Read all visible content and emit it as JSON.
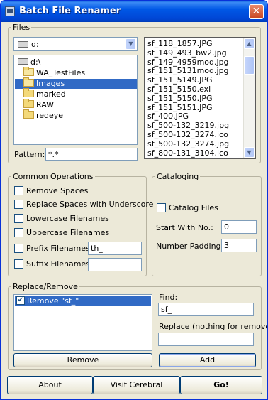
{
  "window": {
    "title": "Batch File Renamer",
    "close_label": "✕"
  },
  "files": {
    "legend": "Files",
    "drive_value": "d:",
    "tree": [
      {
        "label": "d:\\",
        "indent": 0,
        "icon": "drive"
      },
      {
        "label": "WA_TestFiles",
        "indent": 1,
        "icon": "folder-open"
      },
      {
        "label": "Images",
        "indent": 2,
        "icon": "folder-open",
        "selected": true
      },
      {
        "label": "marked",
        "indent": 3,
        "icon": "folder"
      },
      {
        "label": "RAW",
        "indent": 3,
        "icon": "folder"
      },
      {
        "label": "redeye",
        "indent": 3,
        "icon": "folder"
      }
    ],
    "pattern_label": "Pattern:",
    "pattern_value": "*.*",
    "list": [
      "sf_118_1857.JPG",
      "sf_149_493_bw2.jpg",
      "sf_149_4959mod.jpg",
      "sf_151_5131mod.jpg",
      "sf_151_5149.JPG",
      "sf_151_5150.exi",
      "sf_151_5150.JPG",
      "sf_151_5151.JPG",
      "sf_400.JPG",
      "sf_500-132_3219.jpg",
      "sf_500-132_3274.ico",
      "sf_500-132_3274.jpg",
      "sf_800-131_3104.ico"
    ]
  },
  "common": {
    "legend": "Common Operations",
    "remove_spaces": "Remove Spaces",
    "replace_spaces": "Replace Spaces with Underscore",
    "lowercase": "Lowercase Filenames",
    "uppercase": "Uppercase Filenames",
    "prefix": "Prefix Filenames",
    "prefix_value": "th_",
    "suffix": "Suffix Filenames",
    "suffix_value": ""
  },
  "cataloging": {
    "legend": "Cataloging",
    "catalog_files": "Catalog Files",
    "start_with_label": "Start With No.:",
    "start_with_value": "0",
    "padding_label": "Number Padding:",
    "padding_value": "3"
  },
  "replace": {
    "legend": "Replace/Remove",
    "items": [
      "Remove \"sf_\""
    ],
    "find_label": "Find:",
    "find_value": "sf_",
    "replace_label": "Replace (nothing for remove):",
    "replace_value": "",
    "remove_button": "Remove",
    "add_button": "Add"
  },
  "footer": {
    "about": "About",
    "visit": "Visit Cerebral Synergy",
    "go": "Go!"
  }
}
